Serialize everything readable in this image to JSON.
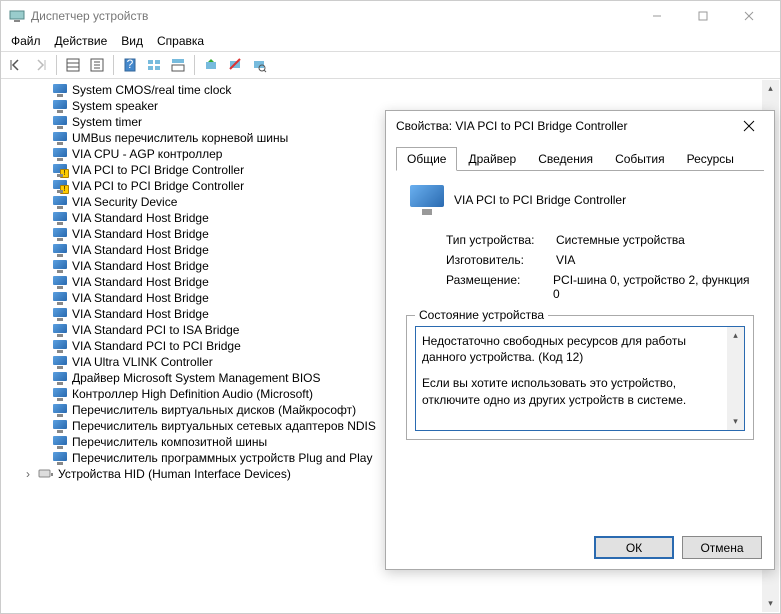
{
  "window": {
    "title": "Диспетчер устройств"
  },
  "menu": {
    "file": "Файл",
    "action": "Действие",
    "view": "Вид",
    "help": "Справка"
  },
  "devices": [
    {
      "label": "System CMOS/real time clock",
      "warn": false
    },
    {
      "label": "System speaker",
      "warn": false
    },
    {
      "label": "System timer",
      "warn": false
    },
    {
      "label": "UMBus перечислитель корневой шины",
      "warn": false
    },
    {
      "label": "VIA CPU - AGP контроллер",
      "warn": false
    },
    {
      "label": "VIA PCI to PCI Bridge Controller",
      "warn": true
    },
    {
      "label": "VIA PCI to PCI Bridge Controller",
      "warn": true
    },
    {
      "label": "VIA Security Device",
      "warn": false
    },
    {
      "label": "VIA Standard Host Bridge",
      "warn": false
    },
    {
      "label": "VIA Standard Host Bridge",
      "warn": false
    },
    {
      "label": "VIA Standard Host Bridge",
      "warn": false
    },
    {
      "label": "VIA Standard Host Bridge",
      "warn": false
    },
    {
      "label": "VIA Standard Host Bridge",
      "warn": false
    },
    {
      "label": "VIA Standard Host Bridge",
      "warn": false
    },
    {
      "label": "VIA Standard Host Bridge",
      "warn": false
    },
    {
      "label": "VIA Standard PCI to ISA Bridge",
      "warn": false
    },
    {
      "label": "VIA Standard PCI to PCI Bridge",
      "warn": false
    },
    {
      "label": "VIA Ultra VLINK Controller",
      "warn": false
    },
    {
      "label": "Драйвер Microsoft System Management BIOS",
      "warn": false
    },
    {
      "label": "Контроллер High Definition Audio (Microsoft)",
      "warn": false
    },
    {
      "label": "Перечислитель виртуальных дисков (Майкрософт)",
      "warn": false
    },
    {
      "label": "Перечислитель виртуальных сетевых адаптеров NDIS",
      "warn": false
    },
    {
      "label": "Перечислитель композитной шины",
      "warn": false
    },
    {
      "label": "Перечислитель программных устройств Plug and Play",
      "warn": false
    }
  ],
  "hid_category": "Устройства HID (Human Interface Devices)",
  "dialog": {
    "title": "Свойства: VIA PCI to PCI Bridge Controller",
    "tabs": {
      "general": "Общие",
      "driver": "Драйвер",
      "details": "Сведения",
      "events": "События",
      "resources": "Ресурсы"
    },
    "device_name": "VIA PCI to PCI Bridge Controller",
    "props": {
      "type_label": "Тип устройства:",
      "type_value": "Системные устройства",
      "mfr_label": "Изготовитель:",
      "mfr_value": "VIA",
      "loc_label": "Размещение:",
      "loc_value": "PCI-шина 0, устройство 2, функция 0"
    },
    "status_legend": "Состояние устройства",
    "status_line1": "Недостаточно свободных ресурсов для работы данного устройства. (Код 12)",
    "status_line2": "Если вы хотите использовать это устройство, отключите одно из других устройств в системе.",
    "ok": "ОК",
    "cancel": "Отмена"
  }
}
